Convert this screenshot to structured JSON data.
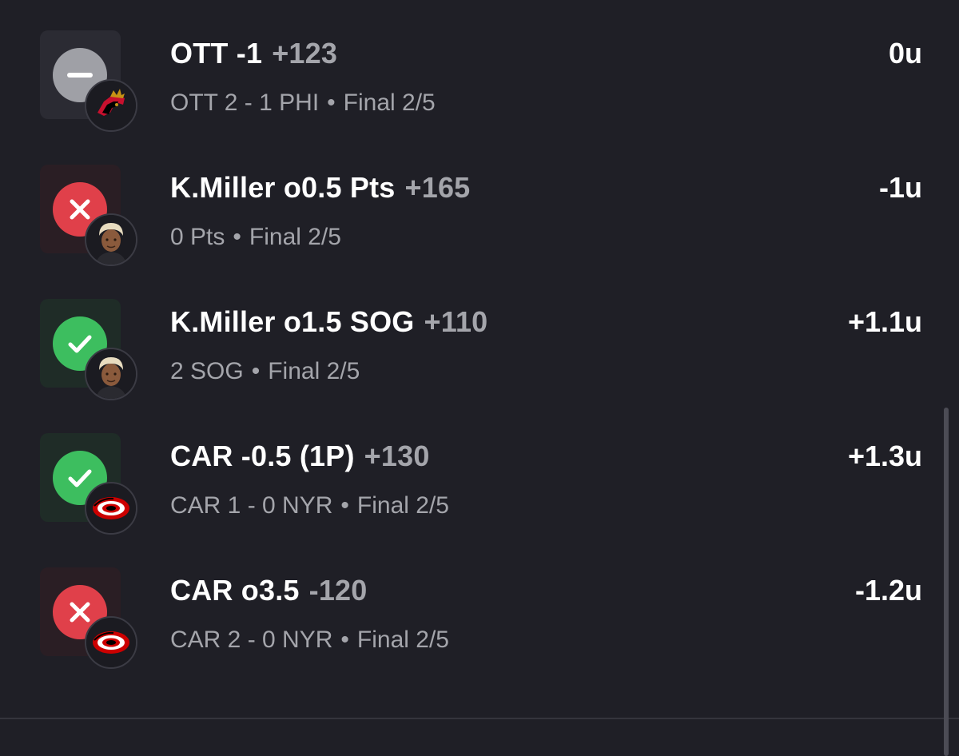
{
  "colors": {
    "background": "#1f1f26",
    "win": "#3dbe5f",
    "loss": "#e0404a",
    "push": "#9fa0a6",
    "secondary_text": "#a4a5ab"
  },
  "bets": [
    {
      "status": "push",
      "status_icon": "minus-icon",
      "badge": "senators-logo",
      "title": "OTT -1",
      "odds": "+123",
      "detail": "OTT 2 - 1 PHI",
      "date": "Final 2/5",
      "units": "0u"
    },
    {
      "status": "loss",
      "status_icon": "x-icon",
      "badge": "player-avatar",
      "title": "K.Miller o0.5 Pts",
      "odds": "+165",
      "detail": "0 Pts",
      "date": "Final 2/5",
      "units": "-1u"
    },
    {
      "status": "win",
      "status_icon": "check-icon",
      "badge": "player-avatar",
      "title": "K.Miller o1.5 SOG",
      "odds": "+110",
      "detail": "2 SOG",
      "date": "Final 2/5",
      "units": "+1.1u"
    },
    {
      "status": "win",
      "status_icon": "check-icon",
      "badge": "hurricanes-logo",
      "title": "CAR -0.5 (1P)",
      "odds": "+130",
      "detail": "CAR 1 - 0 NYR",
      "date": "Final 2/5",
      "units": "+1.3u"
    },
    {
      "status": "loss",
      "status_icon": "x-icon",
      "badge": "hurricanes-logo",
      "title": "CAR o3.5",
      "odds": "-120",
      "detail": "CAR 2 - 0 NYR",
      "date": "Final 2/5",
      "units": "-1.2u"
    }
  ]
}
